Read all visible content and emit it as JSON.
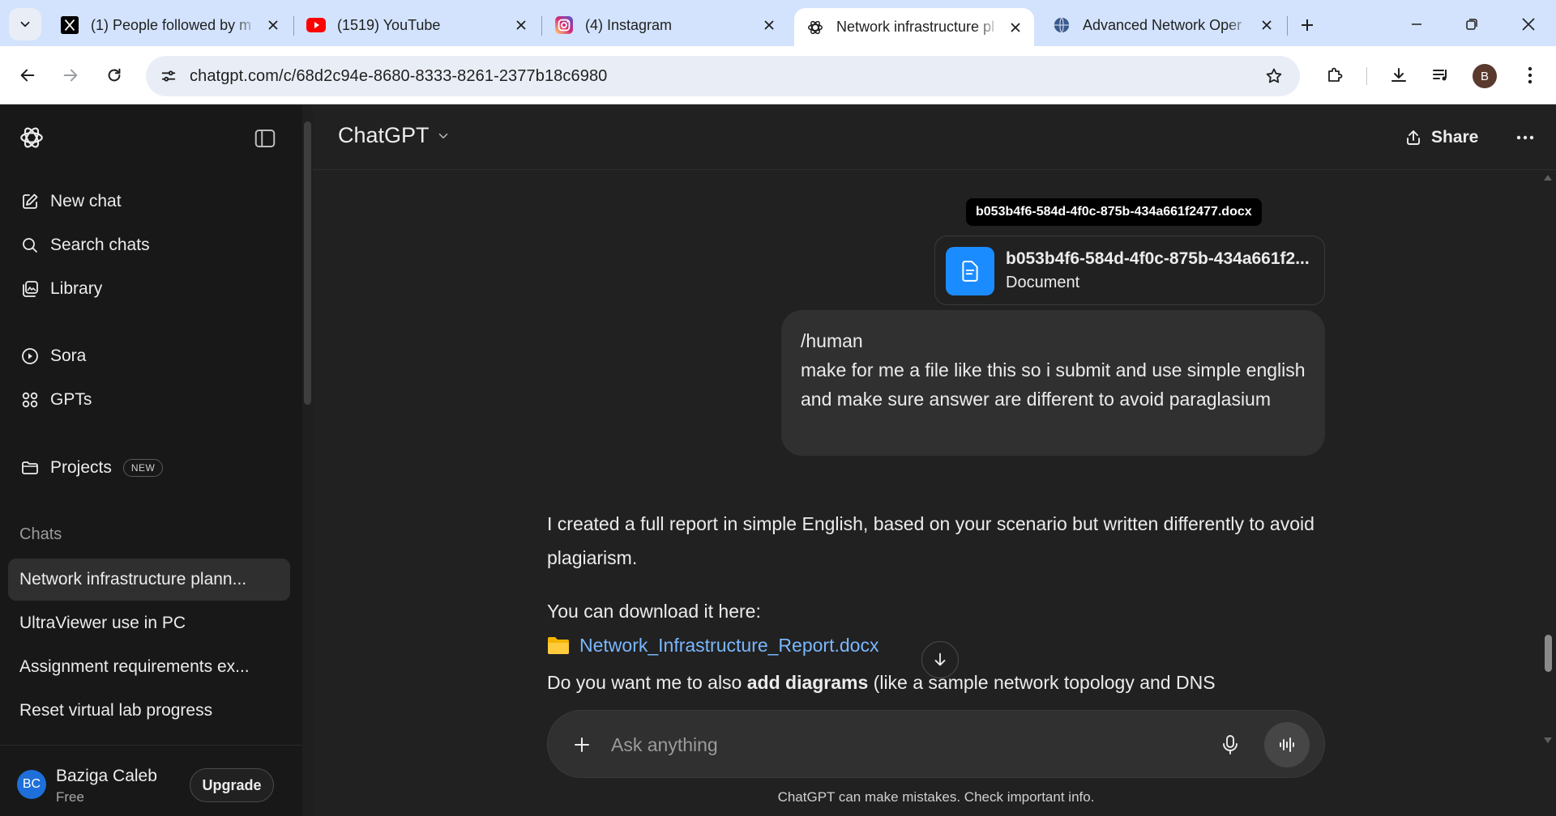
{
  "browser": {
    "tabs": [
      {
        "title": "(1) People followed by m",
        "favicon": "x-logo-icon"
      },
      {
        "title": "(1519) YouTube",
        "favicon": "youtube-icon"
      },
      {
        "title": "(4) Instagram",
        "favicon": "instagram-icon"
      },
      {
        "title": "Network infrastructure pl",
        "favicon": "openai-icon",
        "active": true
      },
      {
        "title": "Advanced Network Oper",
        "favicon": "globe-icon"
      }
    ],
    "url": "chatgpt.com/c/68d2c94e-8680-8333-8261-2377b18c6980",
    "profile_initial": "B"
  },
  "sidebar": {
    "nav": [
      {
        "label": "New chat",
        "icon": "edit-icon"
      },
      {
        "label": "Search chats",
        "icon": "search-icon"
      },
      {
        "label": "Library",
        "icon": "library-icon"
      },
      {
        "label": "Sora",
        "icon": "play-icon"
      },
      {
        "label": "GPTs",
        "icon": "grid-icon"
      },
      {
        "label": "Projects",
        "icon": "folder-icon",
        "badge": "NEW"
      }
    ],
    "section_label": "Chats",
    "chats": [
      {
        "label": "Network infrastructure plann...",
        "active": true
      },
      {
        "label": "UltraViewer use in PC"
      },
      {
        "label": "Assignment requirements ex..."
      },
      {
        "label": "Reset virtual lab progress"
      }
    ],
    "user": {
      "initials": "BC",
      "name": "Baziga Caleb",
      "plan": "Free",
      "upgrade_label": "Upgrade"
    }
  },
  "header": {
    "model": "ChatGPT",
    "share_label": "Share"
  },
  "conversation": {
    "attachment": {
      "tooltip": "b053b4f6-584d-4f0c-875b-434a661f2477.docx",
      "name": "b053b4f6-584d-4f0c-875b-434a661f2...",
      "type": "Document"
    },
    "user_message": "/human\nmake for me a file like this so i submit and use simple english and make sure answer are different to avoid paraglasium",
    "assistant": {
      "p1": "I created a full report in simple English, based on your scenario but written differently to avoid plagiarism.",
      "p2": "You can download it here:",
      "file_link": "Network_Infrastructure_Report.docx",
      "p3_start": "Do you want me to also ",
      "p3_bold": "add diagrams",
      "p3_end": " (like a sample network topology and DNS"
    }
  },
  "composer": {
    "placeholder": "Ask anything",
    "disclaimer": "ChatGPT can make mistakes. Check important info."
  },
  "colors": {
    "accent_blue": "#1a8cff",
    "link": "#7ab7ff",
    "bg": "#212121",
    "sidebar_bg": "#181818"
  }
}
